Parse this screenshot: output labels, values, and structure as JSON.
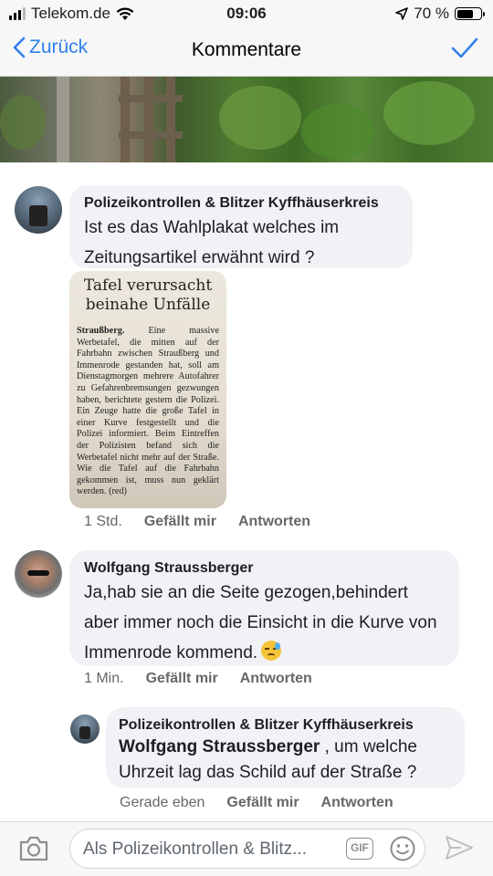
{
  "status": {
    "carrier": "Telekom.de",
    "time": "09:06",
    "battery": "70 %",
    "battery_level": 0.7
  },
  "nav": {
    "back_label": "Zurück",
    "title": "Kommentare"
  },
  "comments": [
    {
      "author": "Polizeikontrollen & Blitzer Kyffhäuserkreis",
      "text": "Ist es das Wahlplakat welches im Zeitungsartikel erwähnt wird ?",
      "time": "1 Std.",
      "like": "Gefällt mir",
      "reply": "Antworten",
      "attachment": {
        "headline": "Tafel verursacht beinahe Unfälle",
        "dateline": "Straußberg.",
        "body": "Eine massive Werbetafel, die mitten auf der Fahrbahn zwischen Straußberg und Immenrode gestanden hat, soll am Dienstagmorgen mehrere Autofahrer zu Gefahrenbremsungen gezwungen haben, berichtete gestern die Polizei. Ein Zeuge hatte die große Tafel in einer Kurve festgestellt und die Polizei informiert. Beim Eintreffen der Polizisten befand sich die Werbetafel nicht mehr auf der Straße. Wie die Tafel auf die Fahrbahn gekommen ist, muss nun geklärt werden. (red)"
      }
    },
    {
      "author": "Wolfgang Straussberger",
      "text": "Ja,hab sie an die Seite gezogen,behindert aber immer noch die Einsicht in die Kurve von Immenrode kommend.",
      "emoji": "downcast-face-with-sweat",
      "time": "1 Min.",
      "like": "Gefällt mir",
      "reply": "Antworten"
    },
    {
      "author": "Polizeikontrollen & Blitzer Kyffhäuserkreis",
      "mention": "Wolfgang Straussberger",
      "text": " , um welche Uhrzeit lag das Schild auf der Straße ?",
      "time": "Gerade eben",
      "like": "Gefällt mir",
      "reply": "Antworten"
    }
  ],
  "composer": {
    "placeholder": "Als Polizeikontrollen & Blitz...",
    "gif_label": "GIF"
  },
  "colors": {
    "accent": "#2f80ed",
    "bubble": "#f0f2f5",
    "meta": "#65676b"
  }
}
